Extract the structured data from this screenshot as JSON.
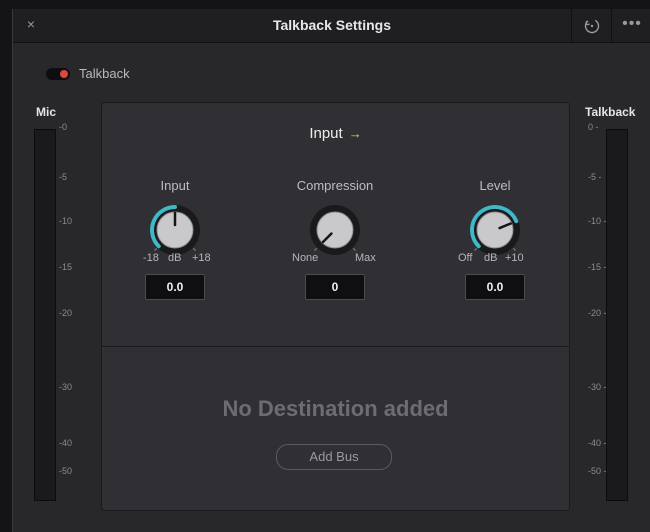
{
  "window": {
    "title": "Talkback Settings",
    "close_icon": "×",
    "more_icon": "•••"
  },
  "toggle": {
    "label": "Talkback",
    "enabled": true,
    "accent": "#e0463e"
  },
  "meters": {
    "left": {
      "title": "Mic",
      "ticks": [
        "-0",
        "-5",
        "-10",
        "-15",
        "-20",
        "-30",
        "-40",
        "-50"
      ]
    },
    "right": {
      "title": "Talkback",
      "ticks": [
        "0 -",
        "-5 -",
        "-10 -",
        "-15 -",
        "-20 -",
        "-30 -",
        "-40 -",
        "-50 -"
      ]
    }
  },
  "panel": {
    "section_title": "Input",
    "section_arrow": "→",
    "knobs": [
      {
        "label": "Input",
        "range_min": "-18",
        "range_unit": "dB",
        "range_max": "+18",
        "value": "0.0",
        "level": 0.5
      },
      {
        "label": "Compression",
        "range_min": "None",
        "range_unit": "",
        "range_max": "Max",
        "value": "0",
        "level": 0.0
      },
      {
        "label": "Level",
        "range_min": "Off",
        "range_unit": "dB",
        "range_max": "+10",
        "value": "0.0",
        "level": 0.75
      }
    ],
    "empty_message": "No Destination added",
    "add_bus_label": "Add Bus"
  },
  "colors": {
    "knob_arc": "#3fb9c9",
    "toggle_dot": "#e0463e",
    "arrow": "#d6e03a"
  }
}
